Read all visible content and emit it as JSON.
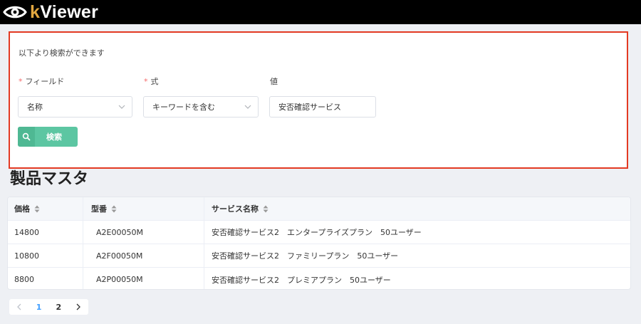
{
  "app": {
    "brand_k": "k",
    "brand_rest": "Viewer",
    "accent": "#e2a740"
  },
  "search": {
    "hint": "以下より検索ができます",
    "field_label": "フィールド",
    "operator_label": "式",
    "value_label": "値",
    "required_mark": "*",
    "field_value": "名称",
    "operator_value": "キーワードを含む",
    "value": "安否確認サービス",
    "button_label": "検索",
    "highlight_color": "#e33a23",
    "button_color": "#5cc6a2"
  },
  "page": {
    "title": "製品マスタ"
  },
  "table": {
    "columns": [
      "価格",
      "型番",
      "サービス名称"
    ],
    "rows": [
      [
        "14800",
        "A2E00050M",
        "安否確認サービス2　エンタープライズプラン　50ユーザー"
      ],
      [
        "10800",
        "A2F00050M",
        "安否確認サービス2　ファミリープラン　50ユーザー"
      ],
      [
        "8800",
        "A2P00050M",
        "安否確認サービス2　プレミアプラン　50ユーザー"
      ]
    ]
  },
  "pagination": {
    "pages": [
      "1",
      "2"
    ],
    "current": "1"
  }
}
